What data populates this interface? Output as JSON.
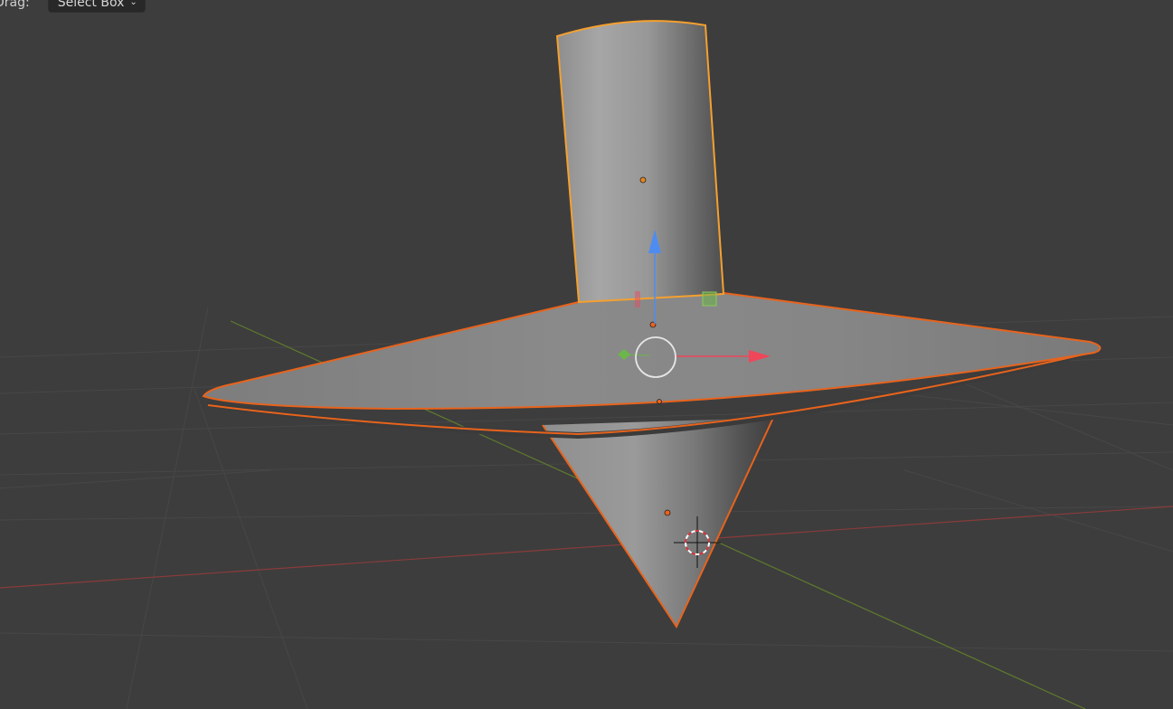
{
  "toolbar": {
    "drag_label": "Drag:",
    "drag_mode": "Select Box"
  },
  "icons": {
    "dropdown": "chevron-down-icon"
  },
  "colors": {
    "background": "#3d3d3d",
    "grid": "#4a4a4a",
    "x_axis": "#8a3b3b",
    "y_axis": "#5f7a2e",
    "selection_outline": "#e8631c",
    "active_outline": "#f5a030",
    "gizmo_x": "#f0465a",
    "gizmo_y": "#6cb74a",
    "gizmo_z": "#4e8cf0"
  }
}
